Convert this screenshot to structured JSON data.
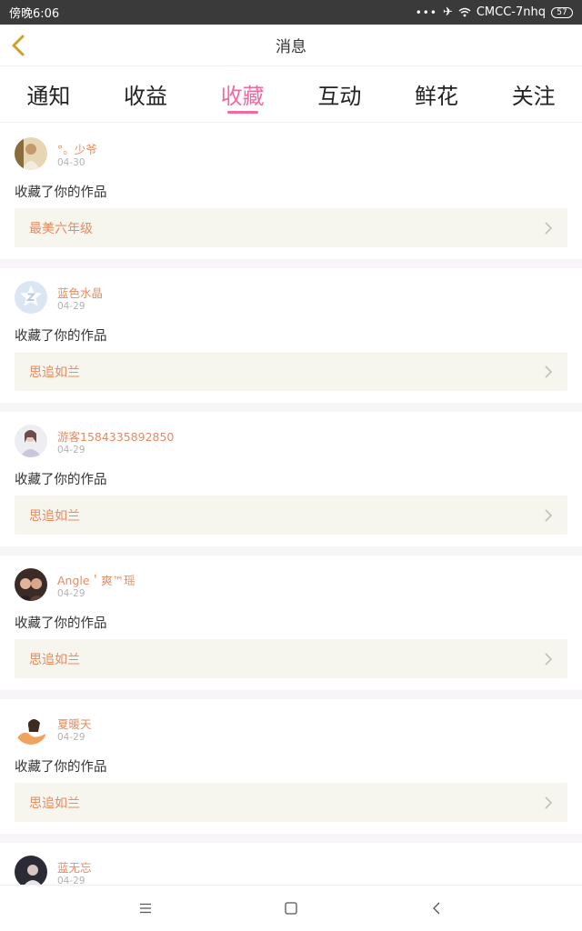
{
  "status_bar": {
    "time": "傍晚6:06",
    "dots": "•••",
    "carrier": "CMCC-7nhq",
    "battery": "57"
  },
  "header": {
    "title": "消息"
  },
  "tabs": [
    {
      "label": "通知",
      "active": false
    },
    {
      "label": "收益",
      "active": false
    },
    {
      "label": "收藏",
      "active": true
    },
    {
      "label": "互动",
      "active": false
    },
    {
      "label": "鲜花",
      "active": false
    },
    {
      "label": "关注",
      "active": false
    }
  ],
  "colors": {
    "accent_pink": "#ee6aa0",
    "username_orange": "#e98a61",
    "card_bg": "#f6f5ee"
  },
  "notifications": [
    {
      "username": "°。少爷",
      "date": "04-30",
      "message": "收藏了你的作品",
      "work_title": "最美六年级",
      "avatar": "photo-avatar"
    },
    {
      "username": "蓝色水晶",
      "date": "04-29",
      "message": "收藏了你的作品",
      "work_title": "思追如兰",
      "avatar": "default-avatar"
    },
    {
      "username": "游客1584335892850",
      "date": "04-29",
      "message": "收藏了你的作品",
      "work_title": "思追如兰",
      "avatar": "photo-avatar"
    },
    {
      "username": "Angle＇爽™瑶",
      "date": "04-29",
      "message": "收藏了你的作品",
      "work_title": "思追如兰",
      "avatar": "photo-avatar"
    },
    {
      "username": "夏暖天",
      "date": "04-29",
      "message": "收藏了你的作品",
      "work_title": "思追如兰",
      "avatar": "photo-avatar"
    },
    {
      "username": "蓝无忘",
      "date": "04-29",
      "message": "",
      "work_title": "",
      "avatar": "photo-avatar"
    }
  ]
}
